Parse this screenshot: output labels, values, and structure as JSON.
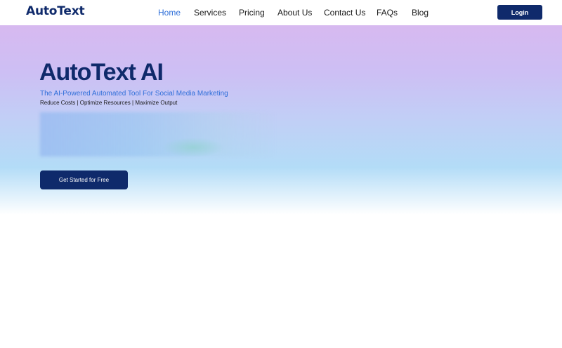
{
  "header": {
    "logo": "AutoText",
    "nav": [
      {
        "label": "Home",
        "active": true
      },
      {
        "label": "Services",
        "active": false
      },
      {
        "label": "Pricing",
        "active": false
      },
      {
        "label": "About Us",
        "active": false
      },
      {
        "label": "Contact Us",
        "active": false
      },
      {
        "label": "FAQs",
        "active": false
      },
      {
        "label": "Blog",
        "active": false
      }
    ],
    "login_label": "Login"
  },
  "hero": {
    "title": "AutoText AI",
    "subtitle": "The AI-Powered Automated Tool For Social Media Marketing",
    "tagline": "Reduce Costs | Optimize Resources | Maximize Output",
    "cta_label": "Get Started for Free"
  },
  "colors": {
    "brand_navy": "#0f2a6b",
    "accent_blue": "#2f6fd9"
  }
}
